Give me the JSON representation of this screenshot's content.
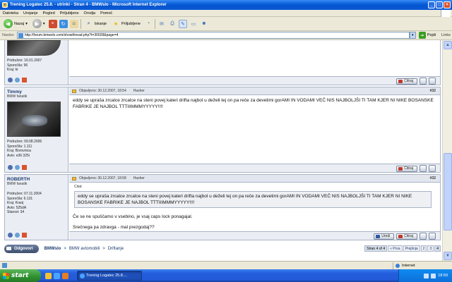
{
  "window": {
    "title": "Trening Logatec 25.8. - utrinki - Stran 4 - BMWslo - Microsoft Internet Explorer"
  },
  "menu": [
    "Datoteka",
    "Urejanje",
    "Pogled",
    "Priljubljene",
    "Orodja",
    "Pomoč"
  ],
  "toolbar": {
    "back": "Nazaj",
    "search": "Iskanje",
    "favorites": "Priljubljene"
  },
  "address": {
    "label": "Naslov",
    "url": "http://forum.bmwslo.com/showthread.php?t=30028&page=4",
    "go": "Pojdi",
    "links": "Links"
  },
  "posts": [
    {
      "info": [
        "Pridružen: 16.01.2007",
        "Sporočila: 96",
        "Kraj: kr"
      ]
    },
    {
      "username": "Timmy",
      "usertitle": "BMW fanatik",
      "info": [
        "Pridružen: 09.08.2006",
        "Sporočila: 1.111",
        "Kraj: Borovnica",
        "Avto: e36 325i"
      ],
      "posted": "Objavljeno: 30.12.2007, 18:54",
      "mode": "Hasher",
      "number": "#32",
      "text": "eddy se upraša zrcalce zrcalce na steni povej kateri drifta najbol u deželi tej on pa reče za devetimi gorAMI IN VODAMI VEČ NIS NAJBOLJŠI TI TAM KJER NI NIKE BOSANSKE FABRIKE JE NAJBOL TTTIIIMMMYYYYY!!!!"
    },
    {
      "username": "ROBERTH",
      "usertitle": "BMW fanatik",
      "info": [
        "Pridružen: 07.11.2004",
        "Sporočila: 6.131",
        "Kraj: Kranj",
        "Avto: 525dA",
        "Starost: 34"
      ],
      "posted": "Objavljeno: 30.12.2007, 18:58",
      "mode": "Hasher",
      "number": "#32",
      "quote_label": "Citat:",
      "quote": "eddy se upraša zrcalce zrcalce na steni povej kateri drifta najbol u deželi tej on pa reče za devetimi gorAMI IN VODAMI VEČ NIS NAJBOLJŠI TI TAM KJER NI NIKE BOSANSKE FABRIKE JE NAJBOL TTTIIIMMMYYYYY!!!!",
      "line1": "Če se ne spuščamo v vsebino, je vsaj caps lock ponagajal.",
      "line2": "Srečnega pa zdravga - mal prezgodaj??"
    }
  ],
  "buttons": {
    "quote": "Citiraj",
    "edit": "Uredi",
    "reply": "Odgovori"
  },
  "breadcrumb": {
    "site": "BMWslo",
    "section": "BMW avtomobili",
    "forum": "Driftanje"
  },
  "pager": {
    "label": "Stran 4 of 4",
    "first": "« Prva",
    "prev": "Prejšnja",
    "pages": [
      "2",
      "3",
      "4"
    ]
  },
  "status": {
    "zone": "Internet"
  },
  "taskbar": {
    "start": "start",
    "task": "Trening Logatec 25.8....",
    "clock": "18:59"
  }
}
